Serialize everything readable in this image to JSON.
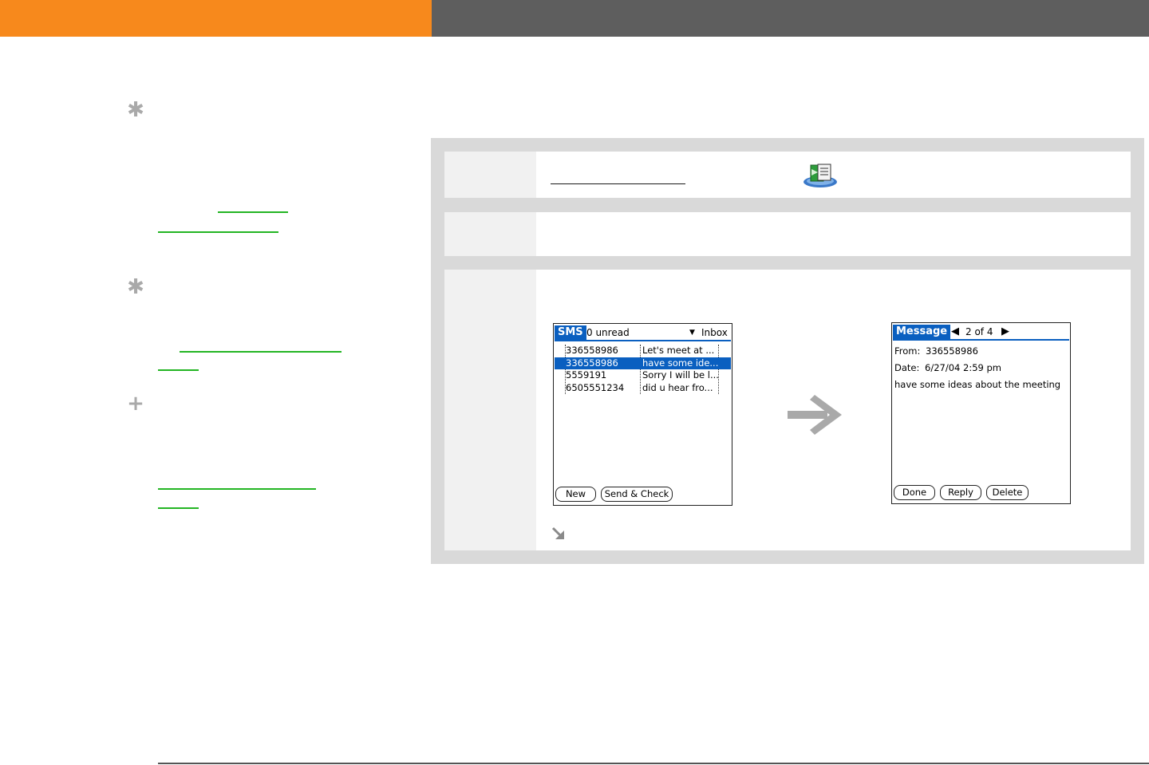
{
  "colors": {
    "header_orange": "#f7891c",
    "header_gray": "#5e5e5e",
    "panel_gray": "#d9d9d9",
    "palm_blue": "#0a5fc0",
    "link_green": "#23b523",
    "marker_gray": "#a9a9a9"
  },
  "sidebar": {
    "markers": [
      {
        "icon": "asterisk-icon",
        "glyph": "✱"
      },
      {
        "icon": "asterisk-icon",
        "glyph": "✱"
      },
      {
        "icon": "plus-icon",
        "glyph": "+"
      }
    ]
  },
  "steps": {
    "app_icon": "sms-app-icon"
  },
  "sms_list_screen": {
    "title": "SMS",
    "unread": "0 unread",
    "folder_arrow": "▼",
    "folder": "Inbox",
    "messages": [
      {
        "number": "336558986",
        "preview": "Let's meet at ...",
        "selected": false
      },
      {
        "number": "336558986",
        "preview": "have some ide...",
        "selected": true
      },
      {
        "number": "5559191",
        "preview": "Sorry I will be l...",
        "selected": false
      },
      {
        "number": "6505551234",
        "preview": "did u hear fro...",
        "selected": false
      }
    ],
    "buttons": {
      "new": "New",
      "send_check": "Send & Check"
    }
  },
  "message_screen": {
    "title": "Message",
    "prev_arrow": "◀",
    "position": "2 of 4",
    "next_arrow": "▶",
    "from_label": "From:",
    "from_value": "336558986",
    "date_label": "Date:",
    "date_value": "6/27/04 2:59 pm",
    "body": "have some ideas about the meeting",
    "buttons": {
      "done": "Done",
      "reply": "Reply",
      "delete": "Delete"
    }
  }
}
